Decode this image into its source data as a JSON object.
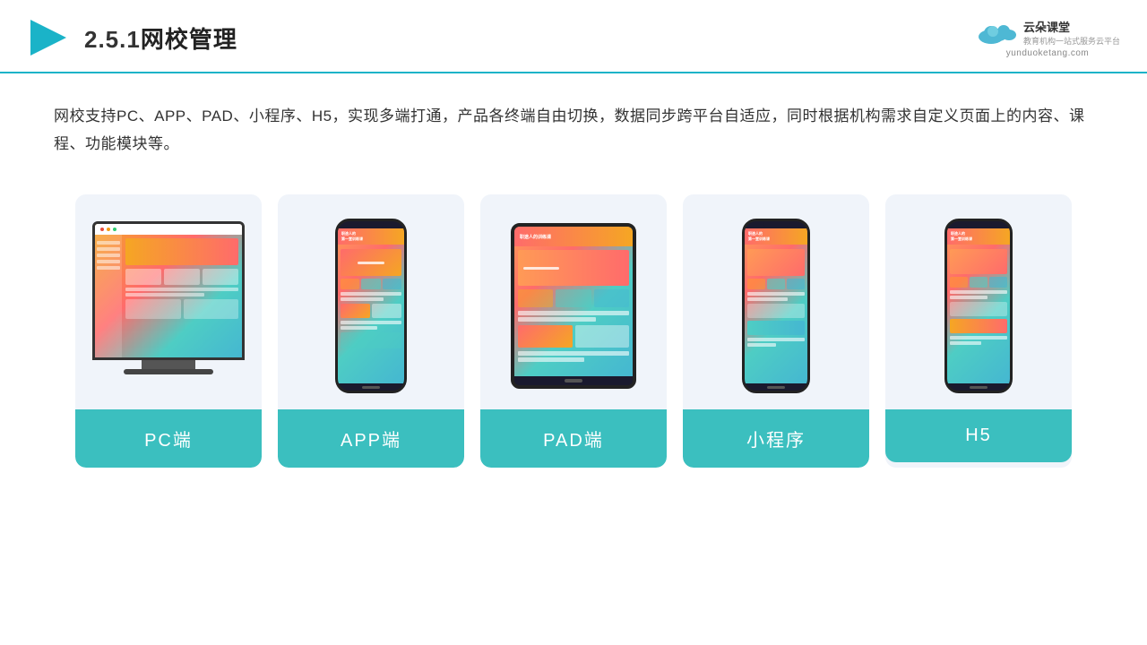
{
  "header": {
    "section_num": "2.5.1",
    "title": "网校管理",
    "logo_url": "yunduoketang.com",
    "logo_slogan": "教育机构一站式服务云平台"
  },
  "description": {
    "text": "网校支持PC、APP、PAD、小程序、H5，实现多端打通，产品各终端自由切换，数据同步跨平台自适应，同时根据机构需求自定义页面上的内容、课程、功能模块等。"
  },
  "cards": [
    {
      "id": "pc",
      "label": "PC端"
    },
    {
      "id": "app",
      "label": "APP端"
    },
    {
      "id": "pad",
      "label": "PAD端"
    },
    {
      "id": "miniprogram",
      "label": "小程序"
    },
    {
      "id": "h5",
      "label": "H5"
    }
  ],
  "colors": {
    "accent": "#3bbfbf",
    "header_line": "#1ab3c8",
    "card_bg": "#f0f4fa",
    "title": "#222222"
  }
}
